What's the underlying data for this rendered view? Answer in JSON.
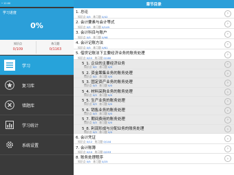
{
  "sidebar": {
    "status_text": "• 12:00",
    "progress_title": "学习进度",
    "progress_value": "0%",
    "stats": [
      {
        "label": "知识点",
        "value": "0/109"
      },
      {
        "label": "练习题",
        "value": "0/1163"
      }
    ],
    "nav": [
      {
        "label": "学习",
        "icon": "list-icon"
      },
      {
        "label": "复习库",
        "icon": "star-icon"
      },
      {
        "label": "错题库",
        "icon": "cross-circle-icon"
      },
      {
        "label": "学习统计",
        "icon": "bar-chart-icon"
      },
      {
        "label": "系统设置",
        "icon": "gear-icon"
      }
    ]
  },
  "main": {
    "header_title": "章节目录",
    "meta_knowledge_label": "知识点",
    "meta_exercise_label": "练习题",
    "rows": [
      {
        "title": "1. 总论",
        "k": "0/5",
        "e": "0/42",
        "sub": false
      },
      {
        "title": "2. 会计要素与会计等式",
        "k": "0/5",
        "e": "0/149",
        "sub": false
      },
      {
        "title": "3. 会计科目与账户",
        "k": "0/5",
        "e": "0/98",
        "sub": false
      },
      {
        "title": "4. 会计记账方法",
        "k": "0/5",
        "e": "0/61",
        "sub": false
      },
      {
        "title": "5. 借贷记账法下主要经济业务的账务处理",
        "k": "0/22",
        "e": "0/160",
        "sub": false
      },
      {
        "title": "5_1. 企业的主要经济业务",
        "k": "0/2",
        "e": "0/0",
        "sub": true
      },
      {
        "title": "5_2. 资金筹集业务的账务处理",
        "k": "0/2",
        "e": "0/0",
        "sub": true
      },
      {
        "title": "5_3. 固定资产业务的账务处理",
        "k": "0/3",
        "e": "0/0",
        "sub": true
      },
      {
        "title": "5_4. 材料采购业务的账务处理",
        "k": "0/3",
        "e": "0/0",
        "sub": true
      },
      {
        "title": "5_5. 生产业务的账务处理",
        "k": "0/3",
        "e": "0/0",
        "sub": true
      },
      {
        "title": "5_6. 销售业务的账务处理",
        "k": "0/3",
        "e": "0/0",
        "sub": true
      },
      {
        "title": "5_7. 期间费用的账务处理",
        "k": "0/3",
        "e": "0/0",
        "sub": true
      },
      {
        "title": "5_8. 利润形成与分配业务的账务处理",
        "k": "0/3",
        "e": "0/0",
        "sub": true
      },
      {
        "title": "6. 会计凭证",
        "k": "0/12",
        "e": "0/144",
        "sub": false
      },
      {
        "title": "7. 会计账簿",
        "k": "0/10",
        "e": "0/253",
        "sub": false
      },
      {
        "title": "8. 账务处理程序",
        "k": "0/5",
        "e": "0/25",
        "sub": false
      }
    ]
  },
  "colors": {
    "accent": "#2b9fd9",
    "sidebar_bg": "#3a3a3a",
    "stat_red": "#d02a2a",
    "link_blue": "#2a6fd6"
  }
}
